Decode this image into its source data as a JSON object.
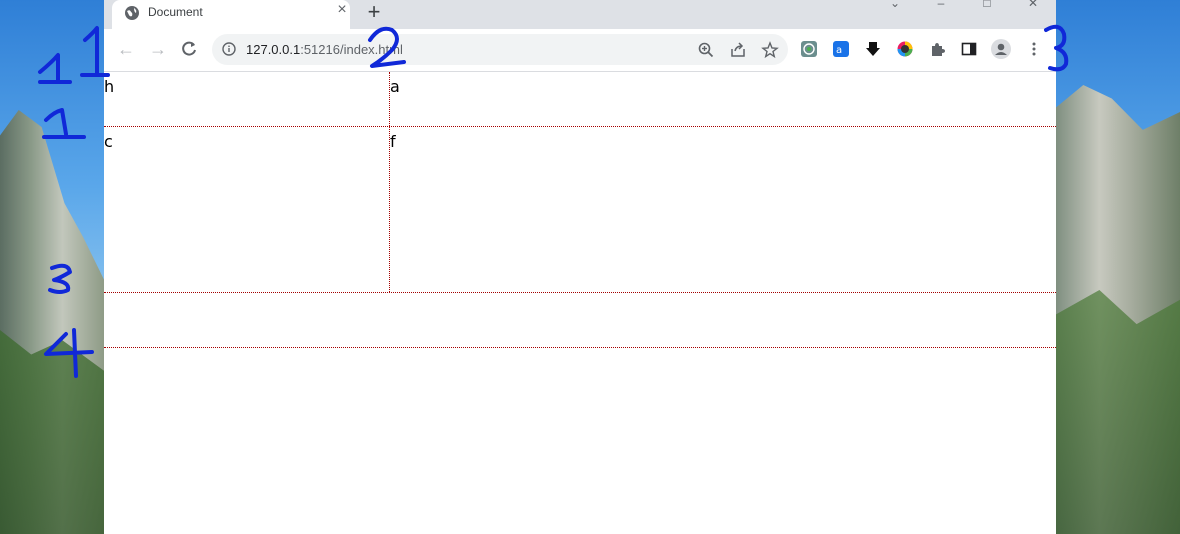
{
  "tab": {
    "title": "Document"
  },
  "address_bar": {
    "host": "127.0.0.1",
    "rest": ":51216/index.html"
  },
  "page": {
    "cells": [
      "h",
      "a",
      "c",
      "f"
    ]
  },
  "annotations": [
    "11",
    "2",
    "3",
    "1",
    "3",
    "4"
  ],
  "colors": {
    "grid_line": "#a40000",
    "annotation_ink": "#1028d8"
  }
}
